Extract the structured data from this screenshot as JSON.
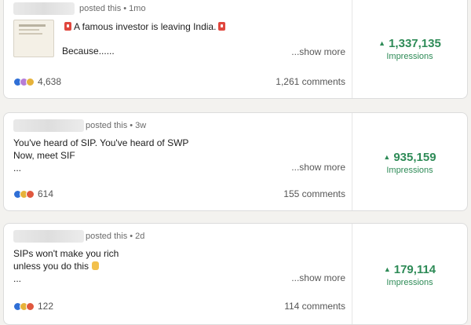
{
  "posts": [
    {
      "meta": "posted this • 1mo",
      "lines": [
        "A famous investor is leaving India.",
        "",
        "Because......"
      ],
      "show_more": "...show more",
      "reactions": "4,638",
      "comments": "1,261 comments",
      "impressions": "1,337,135",
      "impressions_label": "Impressions"
    },
    {
      "meta": "posted this • 3w",
      "lines": [
        "You've heard of SIP. You've heard of SWP",
        "Now, meet SIF",
        "..."
      ],
      "show_more": "...show more",
      "reactions": "614",
      "comments": "155 comments",
      "impressions": "935,159",
      "impressions_label": "Impressions"
    },
    {
      "meta": "posted this • 2d",
      "lines": [
        "SIPs won't make you rich",
        "unless you do this",
        "..."
      ],
      "show_more": "...show more",
      "reactions": "122",
      "comments": "114 comments",
      "impressions": "179,114",
      "impressions_label": "Impressions"
    }
  ],
  "icons": {
    "trend": "up-triangle-icon",
    "reactions": [
      "like-icon",
      "celebrate-icon",
      "support-icon",
      "love-icon",
      "insight-icon"
    ],
    "emoji_post1": "red-alert-icon",
    "emoji_post3": "pointing-down-hand-icon"
  },
  "colors": {
    "accent_green": "#2e8b57"
  }
}
